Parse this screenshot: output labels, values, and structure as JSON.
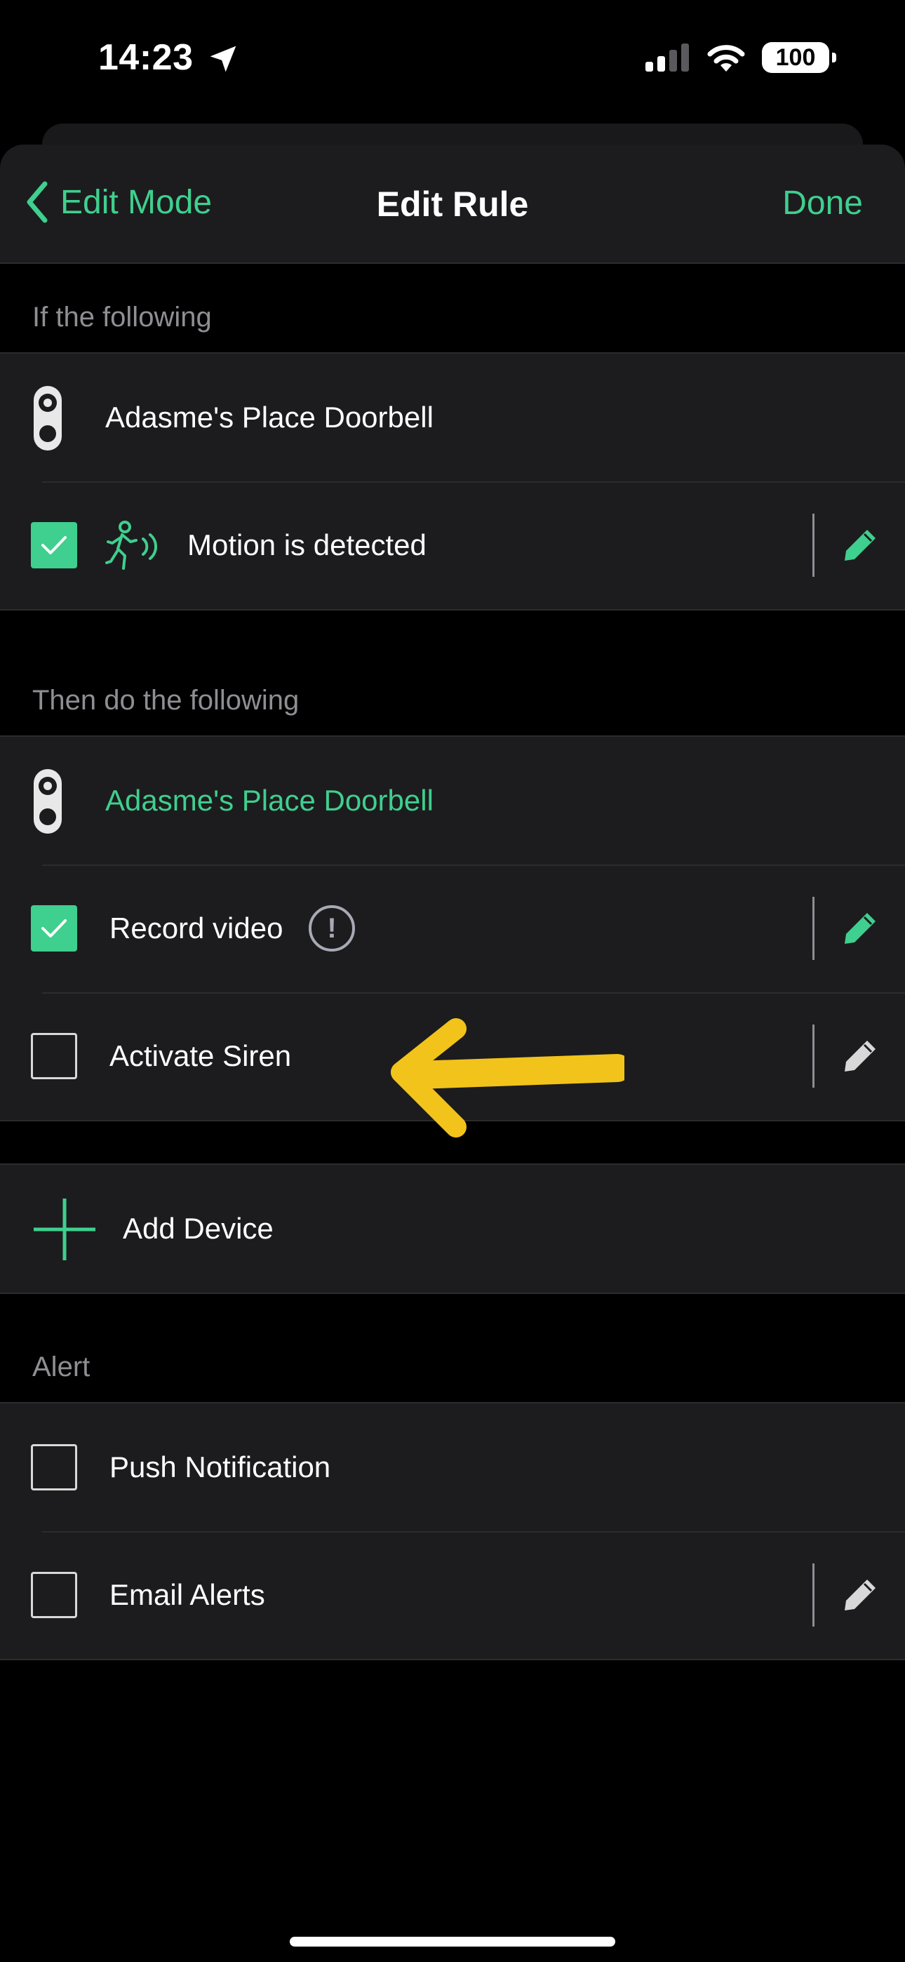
{
  "status_bar": {
    "time": "14:23",
    "battery": "100"
  },
  "nav": {
    "back_label": "Edit Mode",
    "title": "Edit Rule",
    "done_label": "Done"
  },
  "trigger_section": {
    "header": "If the following",
    "device_name": "Adasme's Place Doorbell",
    "items": [
      {
        "label": "Motion is detected",
        "checked": true
      }
    ]
  },
  "action_section": {
    "header": "Then do the following",
    "device_name": "Adasme's Place Doorbell",
    "items": [
      {
        "label": "Record video",
        "checked": true
      },
      {
        "label": "Activate Siren",
        "checked": false
      }
    ]
  },
  "add_device": {
    "label": "Add Device"
  },
  "alert_section": {
    "header": "Alert",
    "items": [
      {
        "label": "Push Notification",
        "checked": false
      },
      {
        "label": "Email Alerts",
        "checked": false
      }
    ]
  },
  "info_icon": {
    "glyph": "!"
  },
  "colors": {
    "accent": "#3fcf8e",
    "annotation": "#f2c31a",
    "row_bg": "#1c1c1e"
  }
}
